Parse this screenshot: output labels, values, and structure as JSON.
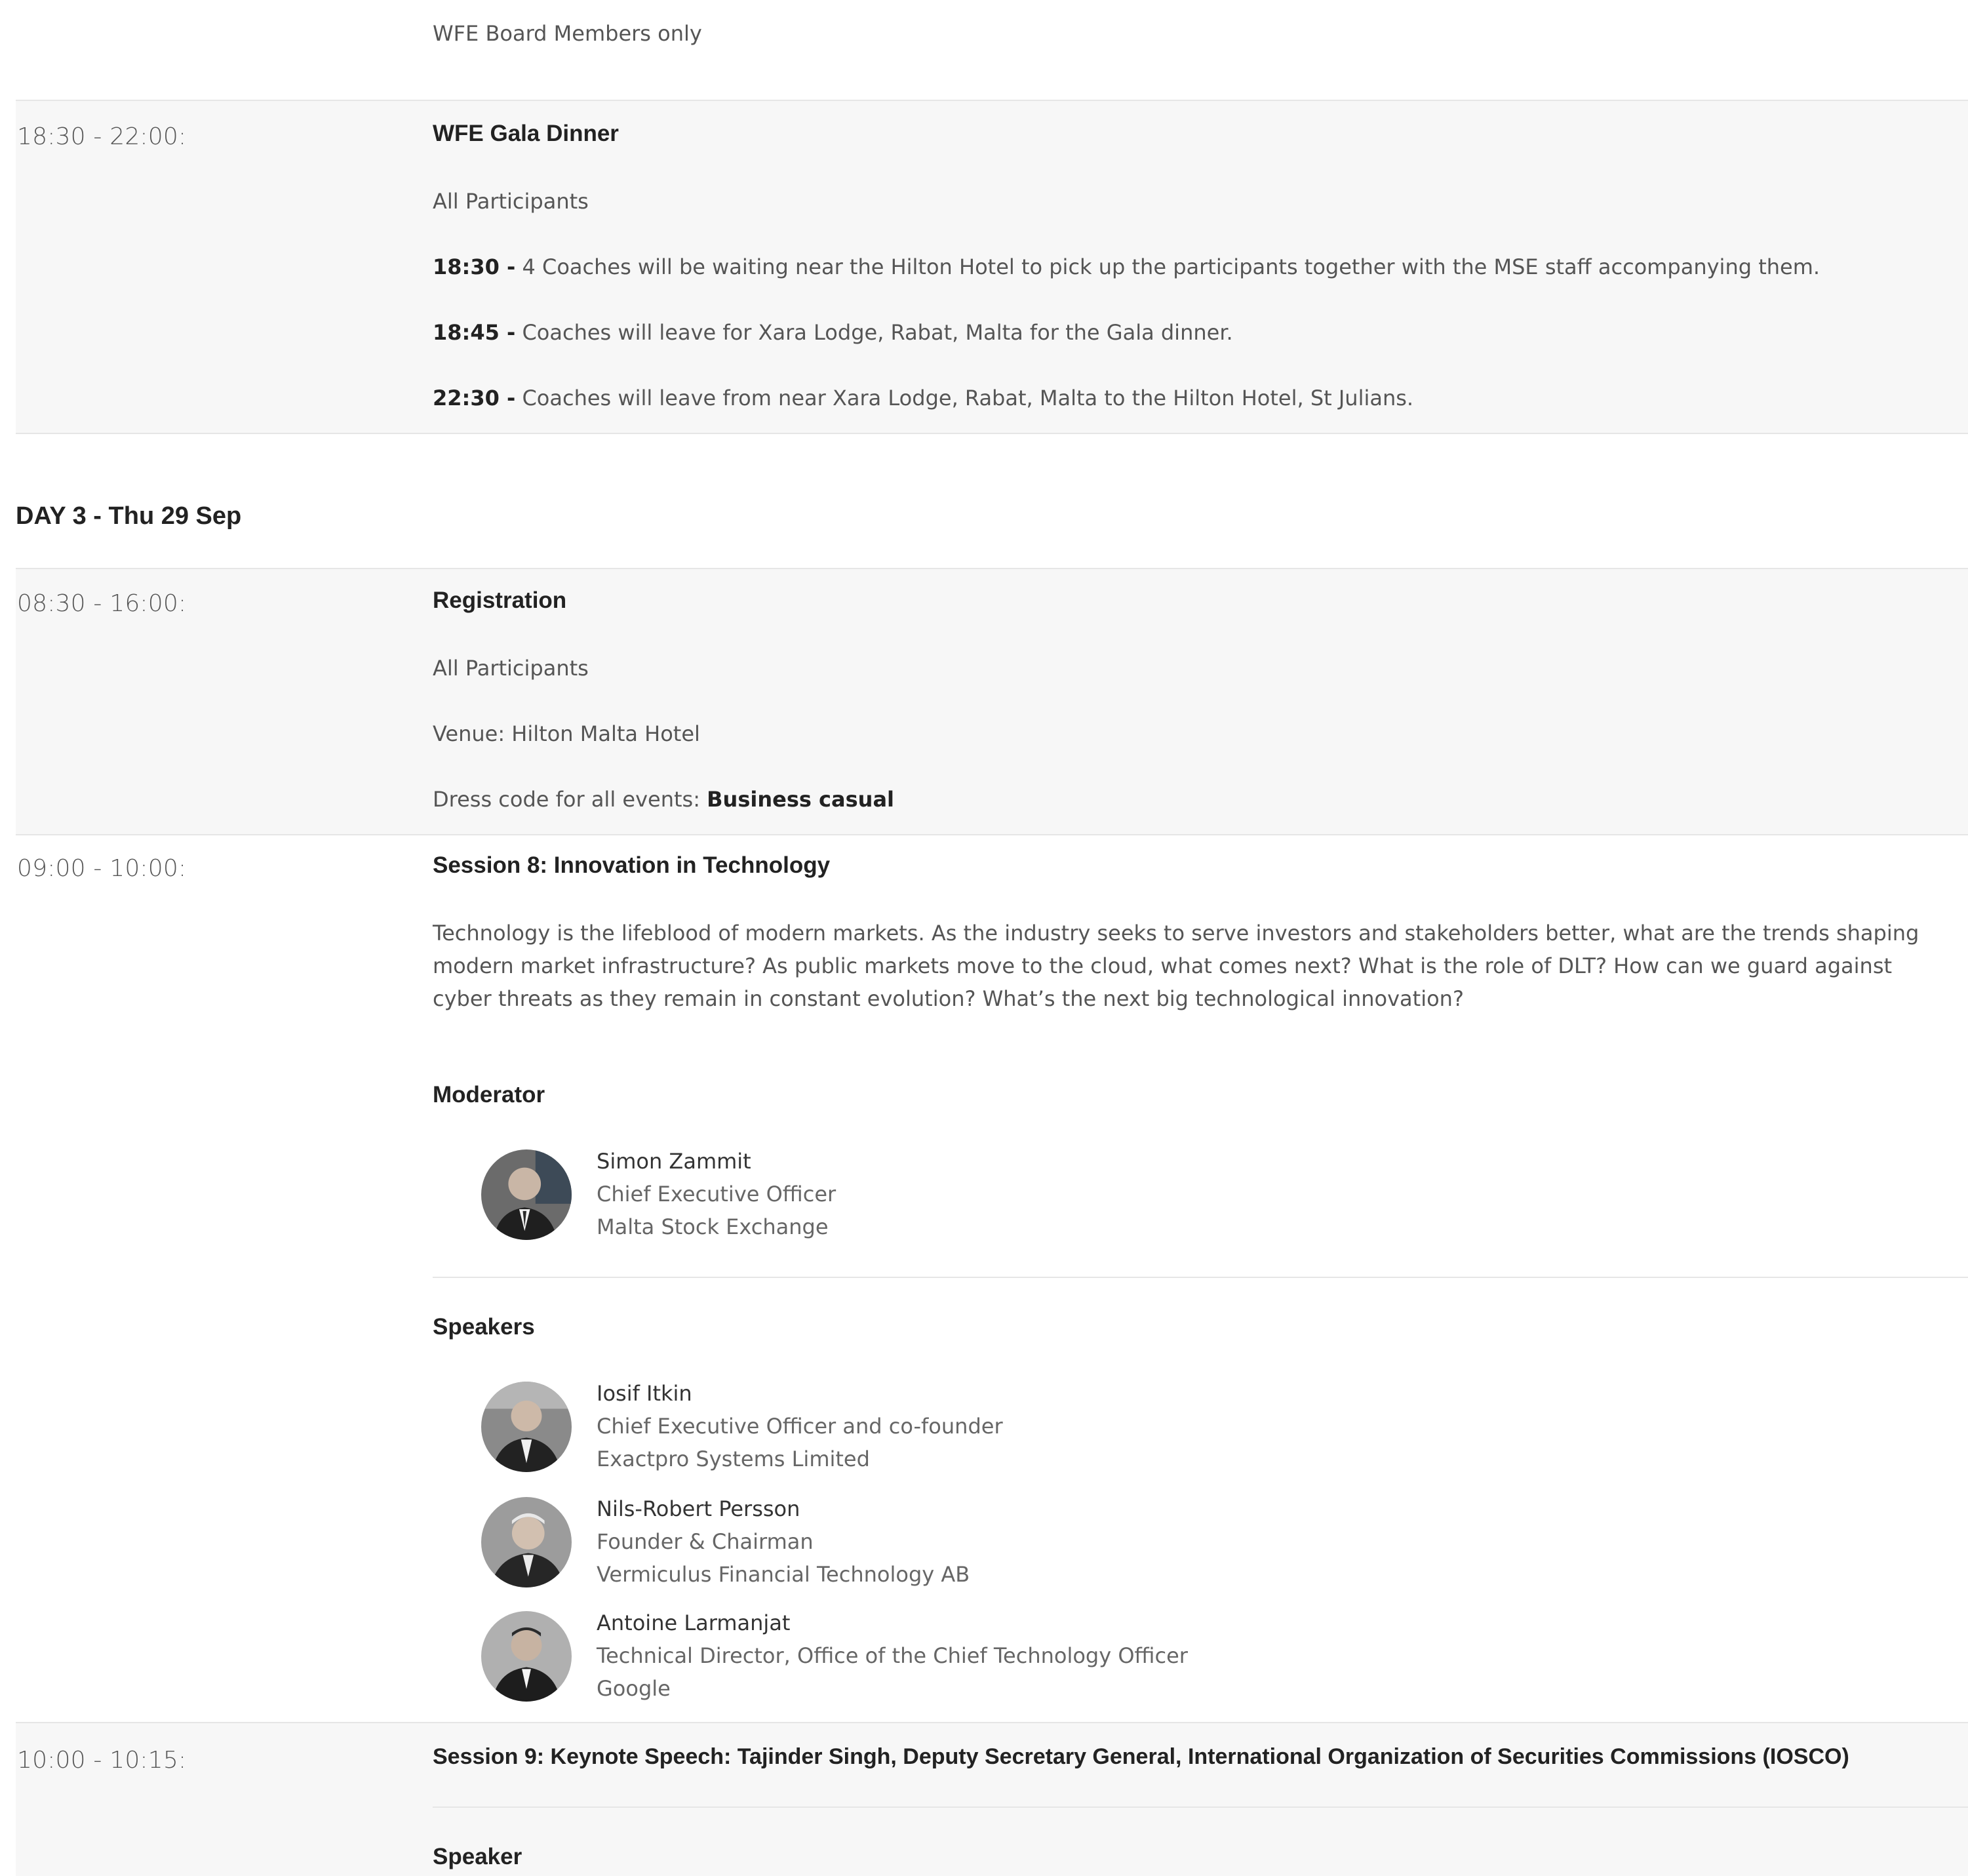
{
  "top_note": "WFE Board Members only",
  "gala": {
    "time": "18:30 - 22:00:",
    "title": "WFE Gala Dinner",
    "audience": "All Participants",
    "items": [
      {
        "time": "18:30 -",
        "text": " 4 Coaches will be waiting near the Hilton Hotel to pick up the participants together with the MSE staff accompanying them."
      },
      {
        "time": "18:45 -",
        "text": " Coaches will leave for Xara Lodge, Rabat, Malta for the Gala dinner."
      },
      {
        "time": "22:30 -",
        "text": " Coaches will leave from near Xara Lodge, Rabat, Malta to the Hilton Hotel, St Julians."
      }
    ]
  },
  "day3": {
    "heading": "DAY 3 - Thu 29 Sep"
  },
  "registration": {
    "time": "08:30 - 16:00:",
    "title": "Registration",
    "audience": "All Participants",
    "venue": "Venue: Hilton Malta Hotel",
    "dress_prefix": "Dress code for all events: ",
    "dress_value": "Business casual"
  },
  "session8": {
    "time": "09:00 - 10:00:",
    "title": "Session 8: Innovation in Technology",
    "description": "Technology is the lifeblood of modern markets. As the industry seeks to serve investors and stakeholders better, what are the trends shaping modern market infrastructure? As public markets move to the cloud, what comes next? What is the role of DLT? How can we guard against cyber threats as they remain in constant evolution? What’s the next big technological innovation?",
    "moderator_label": "Moderator",
    "moderator": {
      "name": "Simon Zammit",
      "role": "Chief Executive Officer",
      "org": "Malta Stock Exchange"
    },
    "speakers_label": "Speakers",
    "speakers": [
      {
        "name": "Iosif Itkin",
        "role": "Chief Executive Officer and co-founder",
        "org": "Exactpro Systems Limited"
      },
      {
        "name": "Nils-Robert Persson",
        "role": "Founder & Chairman",
        "org": "Vermiculus Financial Technology AB"
      },
      {
        "name": "Antoine Larmanjat",
        "role": "Technical Director, Office of the Chief Technology Officer",
        "org": "Google"
      }
    ]
  },
  "session9": {
    "time": "10:00 - 10:15:",
    "title": "Session 9: Keynote Speech: Tajinder Singh, Deputy Secretary General, International Organization of Securities Commissions (IOSCO)",
    "speaker_label": "Speaker"
  },
  "colors": {
    "row_background": "#f7f7f7",
    "border": "#e6e6e6",
    "title_text": "#222222",
    "body_text": "#555555"
  }
}
